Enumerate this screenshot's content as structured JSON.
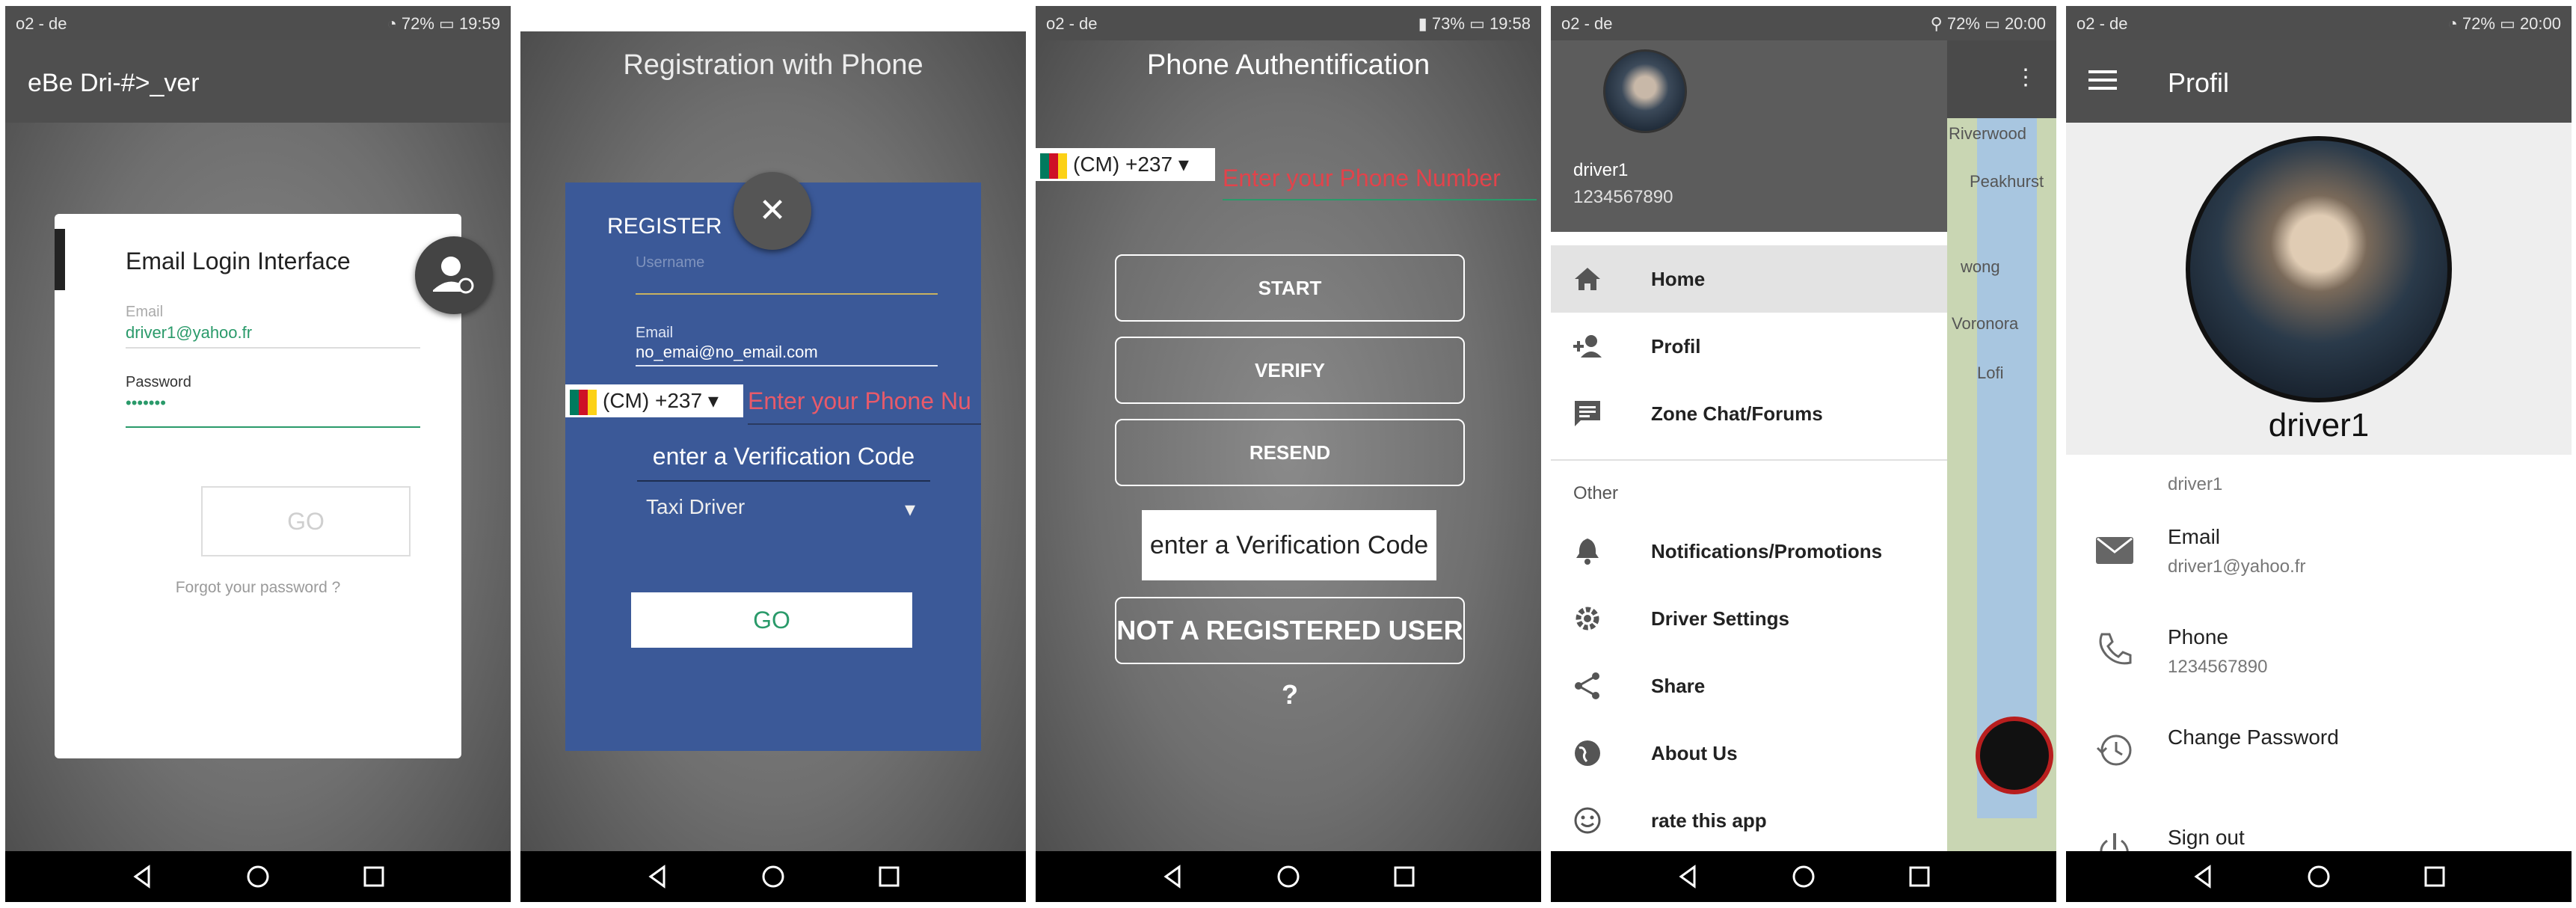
{
  "screen1": {
    "status": {
      "carrier": "o2 - de",
      "battery": "72%",
      "time": "19:59"
    },
    "appbar_title": "eBe Dri-#>_ver",
    "card_title": "Email Login Interface",
    "email_label": "Email",
    "email_value": "driver1@yahoo.fr",
    "password_label": "Password",
    "password_value": "•••••••",
    "go_label": "GO",
    "forgot_label": "Forgot your password ?"
  },
  "screen2": {
    "title": "Registration with Phone",
    "register_title": "REGISTER",
    "close_label": "✕",
    "username_placeholder": "Username",
    "email_label": "Email",
    "email_value": "no_emai@no_email.com",
    "country_code": "(CM) +237",
    "phone_placeholder": "Enter your Phone Nu",
    "verification_placeholder": "enter a Verification Code",
    "driver_type": "Taxi Driver",
    "go_label": "GO"
  },
  "screen3": {
    "status": {
      "carrier": "o2 - de",
      "battery": "73%",
      "time": "19:58"
    },
    "title": "Phone Authentification",
    "country_code": "(CM) +237",
    "phone_placeholder": "Enter your Phone Number",
    "start_label": "START",
    "verify_label": "VERIFY",
    "resend_label": "RESEND",
    "verification_placeholder": "enter a Verification Code",
    "not_registered_label": "NOT A REGISTERED USER ?"
  },
  "screen4": {
    "status": {
      "carrier": "o2 - de",
      "battery": "72%",
      "time": "20:00"
    },
    "drawer_name": "driver1",
    "drawer_phone": "1234567890",
    "items": [
      {
        "label": "Home"
      },
      {
        "label": "Profil"
      },
      {
        "label": "Zone Chat/Forums"
      }
    ],
    "section_other": "Other",
    "other_items": [
      {
        "label": "Notifications/Promotions"
      },
      {
        "label": "Driver Settings"
      },
      {
        "label": "Share"
      },
      {
        "label": "About Us"
      },
      {
        "label": "rate this app"
      }
    ],
    "map_labels": [
      "Riverwood",
      "Peakhurst",
      "wong",
      "Voronora",
      "Lofi"
    ]
  },
  "screen5": {
    "status": {
      "carrier": "o2 - de",
      "battery": "72%",
      "time": "20:00"
    },
    "title": "Profil",
    "name": "driver1",
    "username_value": "driver1",
    "email_label": "Email",
    "email_value": "driver1@yahoo.fr",
    "phone_label": "Phone",
    "phone_value": "1234567890",
    "change_password_label": "Change Password",
    "sign_out_label": "Sign out"
  }
}
